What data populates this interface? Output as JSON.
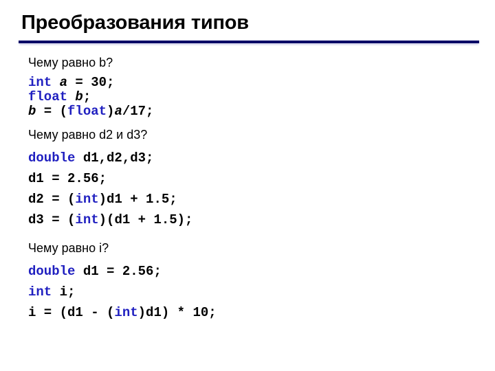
{
  "slide": {
    "title": "Преобразования типов",
    "rule_color": "#000066",
    "background": "#ffffff",
    "keyword_color": "#2020c0",
    "text_color": "#000000"
  },
  "sections": [
    {
      "question": "Чему равно b?",
      "code_lines": [
        {
          "parts": [
            {
              "text": "int",
              "style": "keyword"
            },
            {
              "text": " ",
              "style": "plain"
            },
            {
              "text": "a",
              "style": "italic"
            },
            {
              "text": " = 30;",
              "style": "plain"
            }
          ]
        },
        {
          "parts": [
            {
              "text": "float",
              "style": "keyword"
            },
            {
              "text": " ",
              "style": "plain"
            },
            {
              "text": "b",
              "style": "italic"
            },
            {
              "text": ";",
              "style": "plain"
            }
          ]
        },
        {
          "parts": [
            {
              "text": "b",
              "style": "italic"
            },
            {
              "text": " = (",
              "style": "plain"
            },
            {
              "text": "float",
              "style": "keyword"
            },
            {
              "text": ")",
              "style": "plain"
            },
            {
              "text": "a",
              "style": "italic"
            },
            {
              "text": "/17;",
              "style": "plain"
            }
          ]
        }
      ]
    },
    {
      "question": "Чему равно d2 и d3?",
      "code_lines": [
        {
          "parts": [
            {
              "text": "double",
              "style": "keyword"
            },
            {
              "text": " d1,d2,d3;",
              "style": "plain"
            }
          ]
        },
        {
          "parts": [
            {
              "text": "d1 = 2.56;",
              "style": "plain"
            }
          ]
        },
        {
          "parts": [
            {
              "text": "d2 = (",
              "style": "plain"
            },
            {
              "text": "int",
              "style": "keyword"
            },
            {
              "text": ")d1 + 1.5;",
              "style": "plain"
            }
          ]
        },
        {
          "parts": [
            {
              "text": "d3 = (",
              "style": "plain"
            },
            {
              "text": "int",
              "style": "keyword"
            },
            {
              "text": ")(d1 + 1.5);",
              "style": "plain"
            }
          ]
        }
      ]
    },
    {
      "question": "Чему равно i?",
      "code_lines": [
        {
          "parts": [
            {
              "text": "double",
              "style": "keyword"
            },
            {
              "text": " d1 = 2.56;",
              "style": "plain"
            }
          ]
        },
        {
          "parts": [
            {
              "text": "int",
              "style": "keyword"
            },
            {
              "text": " i;",
              "style": "plain"
            }
          ]
        },
        {
          "parts": [
            {
              "text": "i = (d1 - (",
              "style": "plain"
            },
            {
              "text": "int",
              "style": "keyword"
            },
            {
              "text": ")d1) * 10;",
              "style": "plain"
            }
          ]
        }
      ]
    }
  ]
}
